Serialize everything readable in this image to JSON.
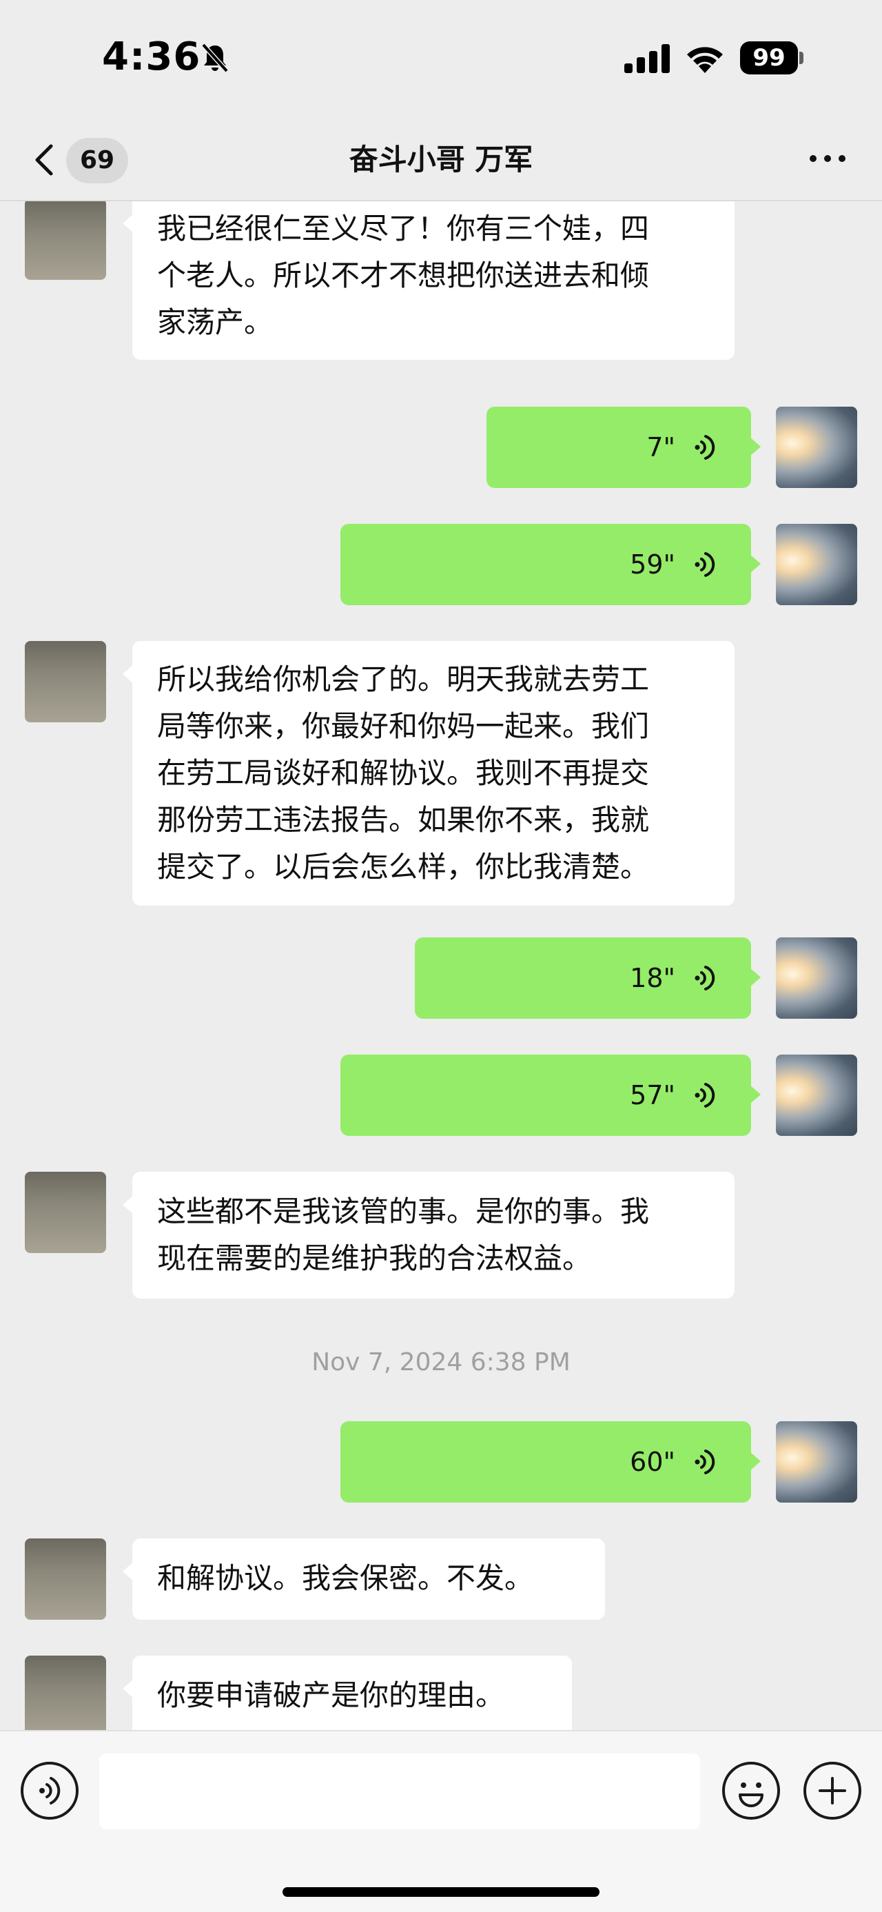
{
  "status_bar": {
    "time": "4:36",
    "battery": "99",
    "icons": [
      "bell-slash-icon",
      "cellular-signal-icon",
      "wifi-icon",
      "battery-icon"
    ]
  },
  "nav": {
    "back_count": "69",
    "title": "奋斗小哥 万军",
    "icons": [
      "chevron-left-icon",
      "more-icon"
    ]
  },
  "messages": [
    {
      "side": "in",
      "lines": [
        "我已经很仁至义尽了！你有三个娃，四",
        "个老人。所以不才不想把你送进去和倾",
        "家荡产。"
      ]
    },
    {
      "side": "out",
      "voice": "7\""
    },
    {
      "side": "out",
      "voice": "59\""
    },
    {
      "side": "in",
      "lines": [
        "所以我给你机会了的。明天我就去劳工",
        "局等你来，你最好和你妈一起来。我们",
        "在劳工局谈好和解协议。我则不再提交",
        "那份劳工违法报告。如果你不来，我就",
        "提交了。以后会怎么样，你比我清楚。"
      ]
    },
    {
      "side": "out",
      "voice": "18\""
    },
    {
      "side": "out",
      "voice": "57\""
    },
    {
      "side": "in",
      "lines": [
        "这些都不是我该管的事。是你的事。我",
        "现在需要的是维护我的合法权益。"
      ]
    },
    {
      "side": "time",
      "text": "Nov 7, 2024 6:38 PM"
    },
    {
      "side": "out",
      "voice": "60\""
    },
    {
      "side": "in",
      "lines": [
        "和解协议。我会保密。不发。"
      ]
    },
    {
      "side": "in",
      "lines": [
        "你要申请破产是你的理由。"
      ]
    }
  ],
  "input_bar": {
    "value": "",
    "icons": [
      "voice-mode-icon",
      "emoji-icon",
      "plus-icon"
    ]
  },
  "colors": {
    "background": "#ededed",
    "outgoing_bubble": "#95ec69",
    "incoming_bubble": "#ffffff"
  }
}
